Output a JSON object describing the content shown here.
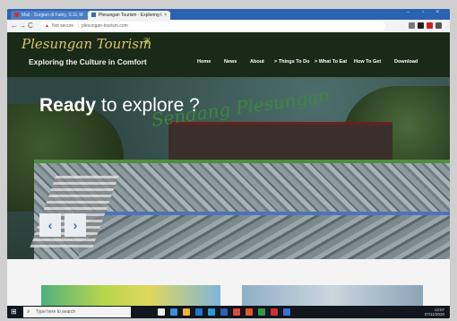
{
  "browser": {
    "tabs": [
      {
        "label": "Mail - Surgian di Fatiry, S.Si, M",
        "active": false
      },
      {
        "label": "Plesungan Tourism - Exploring t",
        "active": true
      }
    ],
    "new_tab": "+",
    "window_controls": "– ▫ ×",
    "url_warning": "Not secure",
    "url": "plesungan-tourism.com"
  },
  "site": {
    "logo": "Plesungan Tourism",
    "tagline": "Exploring the Culture in Comfort",
    "nav": [
      "Home",
      "News",
      "About",
      "> Things To Do",
      "> What To Eat",
      "How To Get",
      "Download"
    ]
  },
  "hero": {
    "headline_bold": "Ready",
    "headline_rest": "to explore ?",
    "sign_text": "Sendang Plesungan",
    "prev_label": "‹",
    "next_label": "›"
  },
  "taskbar": {
    "search_placeholder": "Type here to search",
    "time": "13:07",
    "date": "07/11/2020"
  },
  "colors": {
    "brand_gold": "#d9c36a",
    "header_bg": "#1a2a18",
    "tab_strip": "#2b63b3",
    "carousel_accent": "#2f6fb2"
  }
}
